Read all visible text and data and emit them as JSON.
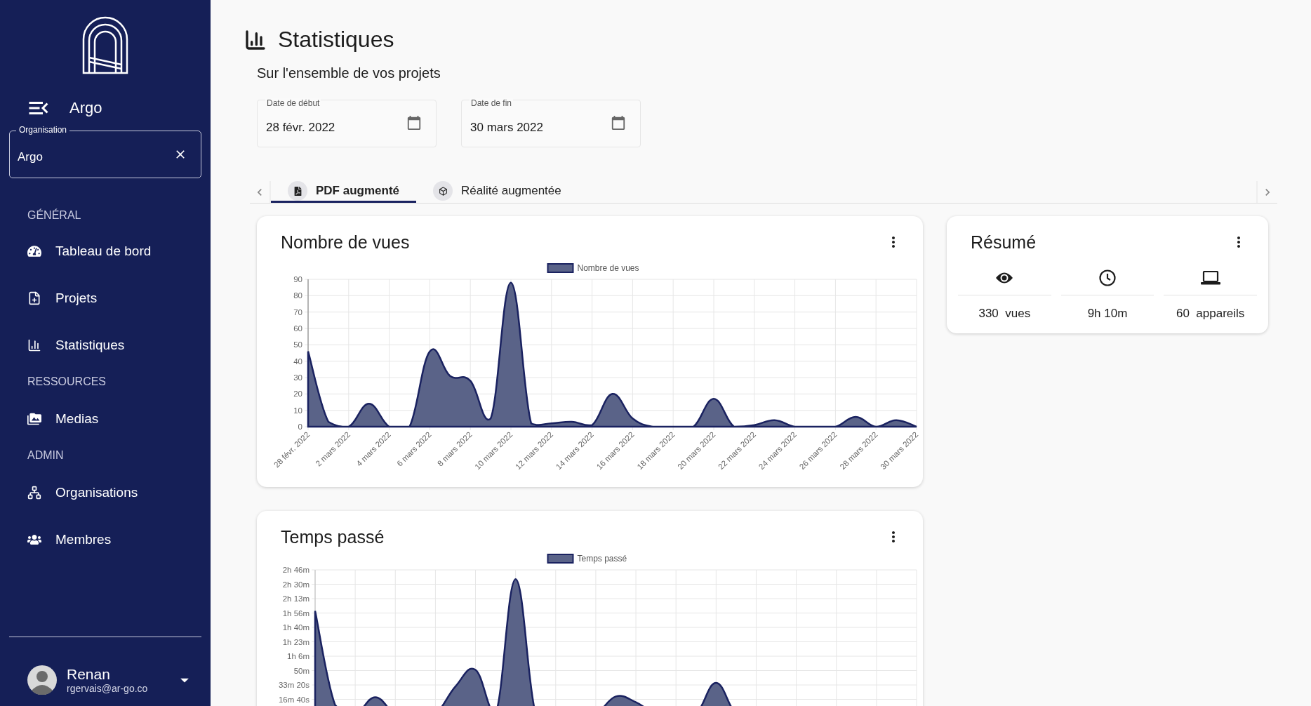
{
  "sidebar": {
    "brand": "Argo",
    "organisation_field": {
      "label": "Organisation",
      "value": "Argo"
    },
    "sections": [
      {
        "title": "GÉNÉRAL",
        "items": [
          {
            "label": "Tableau de bord",
            "kind": "dashboard"
          },
          {
            "label": "Projets",
            "kind": "file"
          },
          {
            "label": "Statistiques",
            "kind": "chart"
          }
        ]
      },
      {
        "title": "RESSOURCES",
        "items": [
          {
            "label": "Medias",
            "kind": "media"
          }
        ]
      },
      {
        "title": "ADMIN",
        "items": [
          {
            "label": "Organisations",
            "kind": "hierarchy"
          },
          {
            "label": "Membres",
            "kind": "people"
          }
        ]
      }
    ],
    "user": {
      "name": "Renan",
      "email": "rgervais@ar-go.co"
    }
  },
  "page": {
    "title": "Statistiques",
    "subtitle": "Sur l'ensemble de vos projets"
  },
  "date_fields": [
    {
      "label": "Date de début",
      "value": "28 févr. 2022"
    },
    {
      "label": "Date de fin",
      "value": "30 mars 2022"
    }
  ],
  "tabs": [
    {
      "label": "PDF augmenté",
      "kind": "pdf",
      "selected": true
    },
    {
      "label": "Réalité augmentée",
      "kind": "cube",
      "selected": false
    }
  ],
  "charts": [
    {
      "title": "Nombre de vues",
      "chart_data": {
        "type": "area",
        "grid": true,
        "categories": [
          "28 févr. 2022",
          null,
          "2 mars 2022",
          null,
          "4 mars 2022",
          null,
          "6 mars 2022",
          null,
          "8 mars 2022",
          null,
          "10 mars 2022",
          null,
          "12 mars 2022",
          null,
          "14 mars 2022",
          null,
          "16 mars 2022",
          null,
          "18 mars 2022",
          null,
          "20 mars 2022",
          null,
          "22 mars 2022",
          null,
          "24 mars 2022",
          null,
          "26 mars 2022",
          null,
          "28 mars 2022",
          null,
          "30 mars 2022"
        ],
        "series": [
          {
            "name": "Nombre de vues",
            "color": "#1a2260",
            "values": [
              46,
              3,
              0,
              14,
              0,
              0,
              46,
              31,
              28,
              5,
              88,
              2,
              2,
              3,
              1,
              20,
              5,
              0,
              0,
              0,
              17,
              0,
              1,
              4,
              0,
              0,
              0,
              6,
              0,
              4,
              0
            ]
          }
        ],
        "ylim": [
          0,
          90
        ],
        "yticks": [
          0,
          10,
          20,
          30,
          40,
          50,
          60,
          70,
          80,
          90
        ]
      }
    },
    {
      "title": "Temps passé",
      "legend": "Temps passé",
      "y_axis_labels": [
        "2h 46m",
        "2h 30m",
        "2h 13m",
        "1h 56m",
        "1h 40m",
        "1h 23m",
        "1h 6m",
        "50m",
        "33m 20s",
        "16m 40s"
      ]
    }
  ],
  "summary": {
    "title": "Résumé",
    "stats": [
      {
        "kind": "views",
        "text": "330  vues"
      },
      {
        "kind": "time",
        "text": "9h 10m"
      },
      {
        "kind": "devices",
        "text": "60  appareils"
      }
    ]
  }
}
